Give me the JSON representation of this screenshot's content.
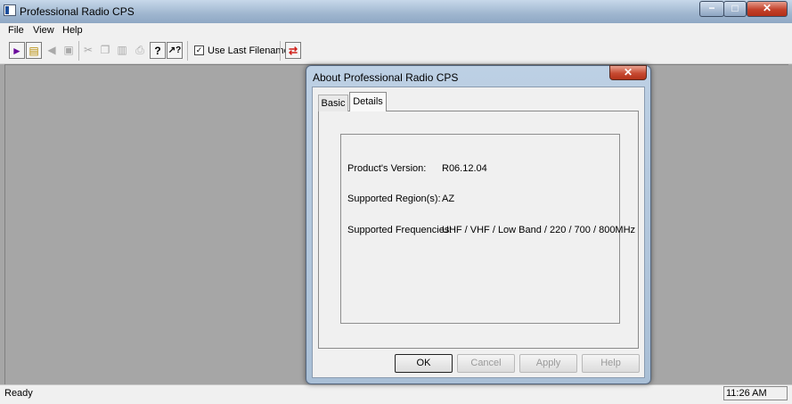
{
  "window": {
    "title": "Professional Radio CPS",
    "min_glyph": "−",
    "max_glyph": "□",
    "close_glyph": "✕"
  },
  "menu": [
    "File",
    "View",
    "Help"
  ],
  "toolbar": {
    "use_last_filename_label": "Use Last Filename",
    "use_last_filename_checked": "✓",
    "icons": {
      "read": "►",
      "open": "▤",
      "back": "◀",
      "save": "▣",
      "cut": "✂",
      "copy": "❐",
      "paste": "▥",
      "print": "⎙",
      "help": "?",
      "whats_this": "↗?",
      "transfer": "⇄"
    }
  },
  "status": {
    "text": "Ready",
    "time": "11:26 AM"
  },
  "dialog": {
    "title": "About Professional Radio CPS",
    "close_glyph": "✕",
    "tabs": [
      "Basic",
      "Details"
    ],
    "active_tab": "Details",
    "details": [
      {
        "label": "Product's Version:",
        "value": "R06.12.04"
      },
      {
        "label": "Supported Region(s):",
        "value": "AZ"
      },
      {
        "label": "Supported Frequencies:",
        "value": "UHF / VHF / Low Band / 220 / 700 / 800MHz"
      }
    ],
    "buttons": {
      "ok": "OK",
      "cancel": "Cancel",
      "apply": "Apply",
      "help": "Help"
    }
  },
  "colors": {
    "titlebar": "#9fb6cf",
    "close_button": "#c3412a",
    "client_background": "#a6a6a6",
    "dialog_background": "#f0f0f0"
  }
}
